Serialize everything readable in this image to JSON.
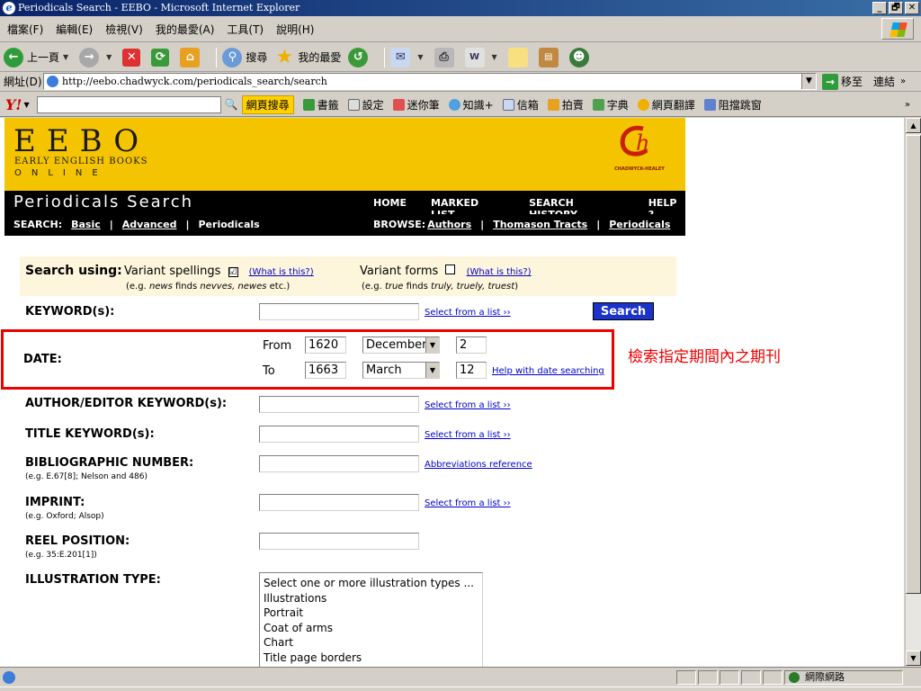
{
  "window": {
    "title": "Periodicals Search - EEBO - Microsoft Internet Explorer",
    "minimize": "_",
    "maximize": "🗗",
    "close": "✕"
  },
  "menu": [
    "檔案(F)",
    "編輯(E)",
    "檢視(V)",
    "我的最愛(A)",
    "工具(T)",
    "說明(H)"
  ],
  "toolbar": {
    "back": "上一頁",
    "search": "搜尋",
    "favorites": "我的最愛"
  },
  "address": {
    "label": "網址(D)",
    "url": "http://eebo.chadwyck.com/periodicals_search/search",
    "go": "移至",
    "links": "連結"
  },
  "yahoo": {
    "logo": "Y!",
    "search_btn": "網頁搜尋",
    "items": [
      "書籤",
      "設定",
      "迷你筆",
      "知識+",
      "信箱",
      "拍賣",
      "字典",
      "網頁翻譯",
      "阻擋跳窗"
    ]
  },
  "header": {
    "logo": "EEBO",
    "sub1": "EARLY ENGLISH BOOKS",
    "sub2": "ONLINE",
    "brand": "CHADWYCK-HEALEY",
    "page_title": "Periodicals Search",
    "nav_top": [
      "HOME",
      "MARKED LIST",
      "SEARCH HISTORY",
      "HELP ?"
    ],
    "search_label": "SEARCH:",
    "search_links": [
      "Basic",
      "Advanced",
      "Periodicals"
    ],
    "browse_label": "BROWSE:",
    "browse_links": [
      "Authors",
      "Thomason Tracts",
      "Periodicals"
    ]
  },
  "search_using": {
    "label": "Search using:",
    "variant_spellings": "Variant spellings",
    "what_is_this": "(What is this?)",
    "eg1_pre": "(e.g. ",
    "eg1_em1": "news",
    "eg1_mid": " finds ",
    "eg1_em2": "nevves, newes",
    "eg1_post": " etc.)",
    "variant_forms": "Variant forms",
    "eg2_pre": "(e.g. ",
    "eg2_em1": "true",
    "eg2_mid": " finds ",
    "eg2_em2": "truly, truely, truest",
    "eg2_post": ")",
    "spellings_checked": "☑",
    "forms_checked": ""
  },
  "fields": {
    "keywords": "KEYWORD(s):",
    "select_from_list": "Select from a list ››",
    "search_button": "Search",
    "date": "DATE:",
    "from": "From",
    "to": "To",
    "author": "AUTHOR/EDITOR KEYWORD(s):",
    "title": "TITLE KEYWORD(s):",
    "biblio": "BIBLIOGRAPHIC NUMBER:",
    "biblio_eg": "(e.g. E.67[8]; Nelson and 486)",
    "abbrev_ref": "Abbreviations reference",
    "imprint": "IMPRINT:",
    "imprint_eg": "(e.g. Oxford; Alsop)",
    "reel": "REEL POSITION:",
    "reel_eg": "(e.g. 35:E.201[1])",
    "illustration": "ILLUSTRATION TYPE:",
    "help_date": "Help with date searching"
  },
  "date": {
    "from_year": "1620",
    "from_month": "December",
    "from_day": "2",
    "to_year": "1663",
    "to_month": "March",
    "to_day": "12"
  },
  "annotation": "檢索指定期間內之期刊",
  "illustration_options": [
    "Select one or more illustration types ...",
    "Illustrations",
    "Portrait",
    "Coat of arms",
    "Chart",
    "Title page borders"
  ],
  "status": {
    "zone": "網際網路"
  },
  "colors": {
    "header_yellow": "#f5c400",
    "nav_black": "#000000",
    "highlight_red": "#e00000",
    "search_blue": "#1b33c8"
  }
}
